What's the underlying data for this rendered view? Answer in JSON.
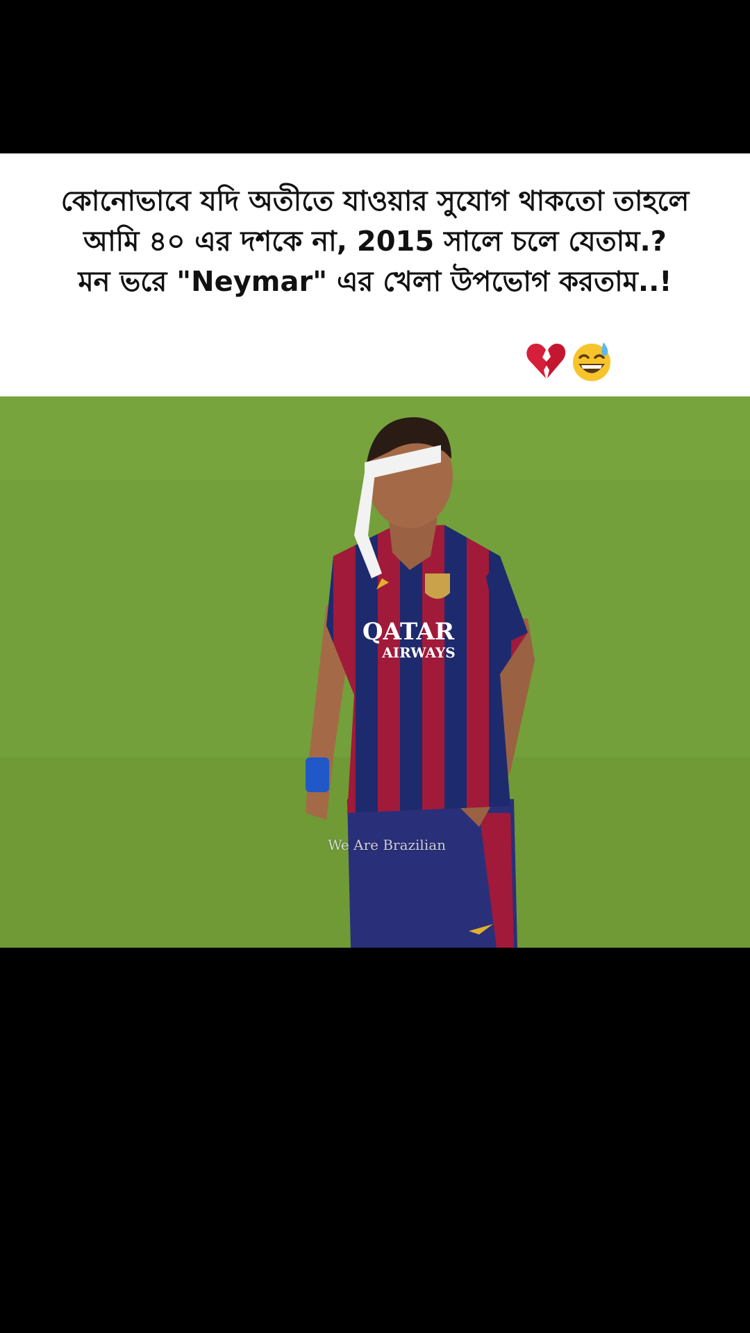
{
  "caption": {
    "lines": [
      "কোনোভাবে যদি অতীতে যাওয়ার সুযোগ থাকতো তাহলে",
      "আমি ৪০ এর দশকে না, 2015 সালে চলে যেতাম.?",
      "মন ভরে \"Neymar\" এর খেলা উপভোগ করতাম..!"
    ],
    "emojis": [
      "broken-heart-icon",
      "grinning-sweat-face-icon"
    ]
  },
  "video": {
    "jersey_sponsor_line1": "QATAR",
    "jersey_sponsor_line2": "AIRWAYS",
    "watermark": "We Are Brazilian"
  },
  "colors": {
    "pitch": "#73a03a",
    "jersey_blue": "#1e2a6e",
    "jersey_red": "#a11a3a",
    "caption_bg": "#ffffff",
    "frame_bg": "#000000"
  }
}
